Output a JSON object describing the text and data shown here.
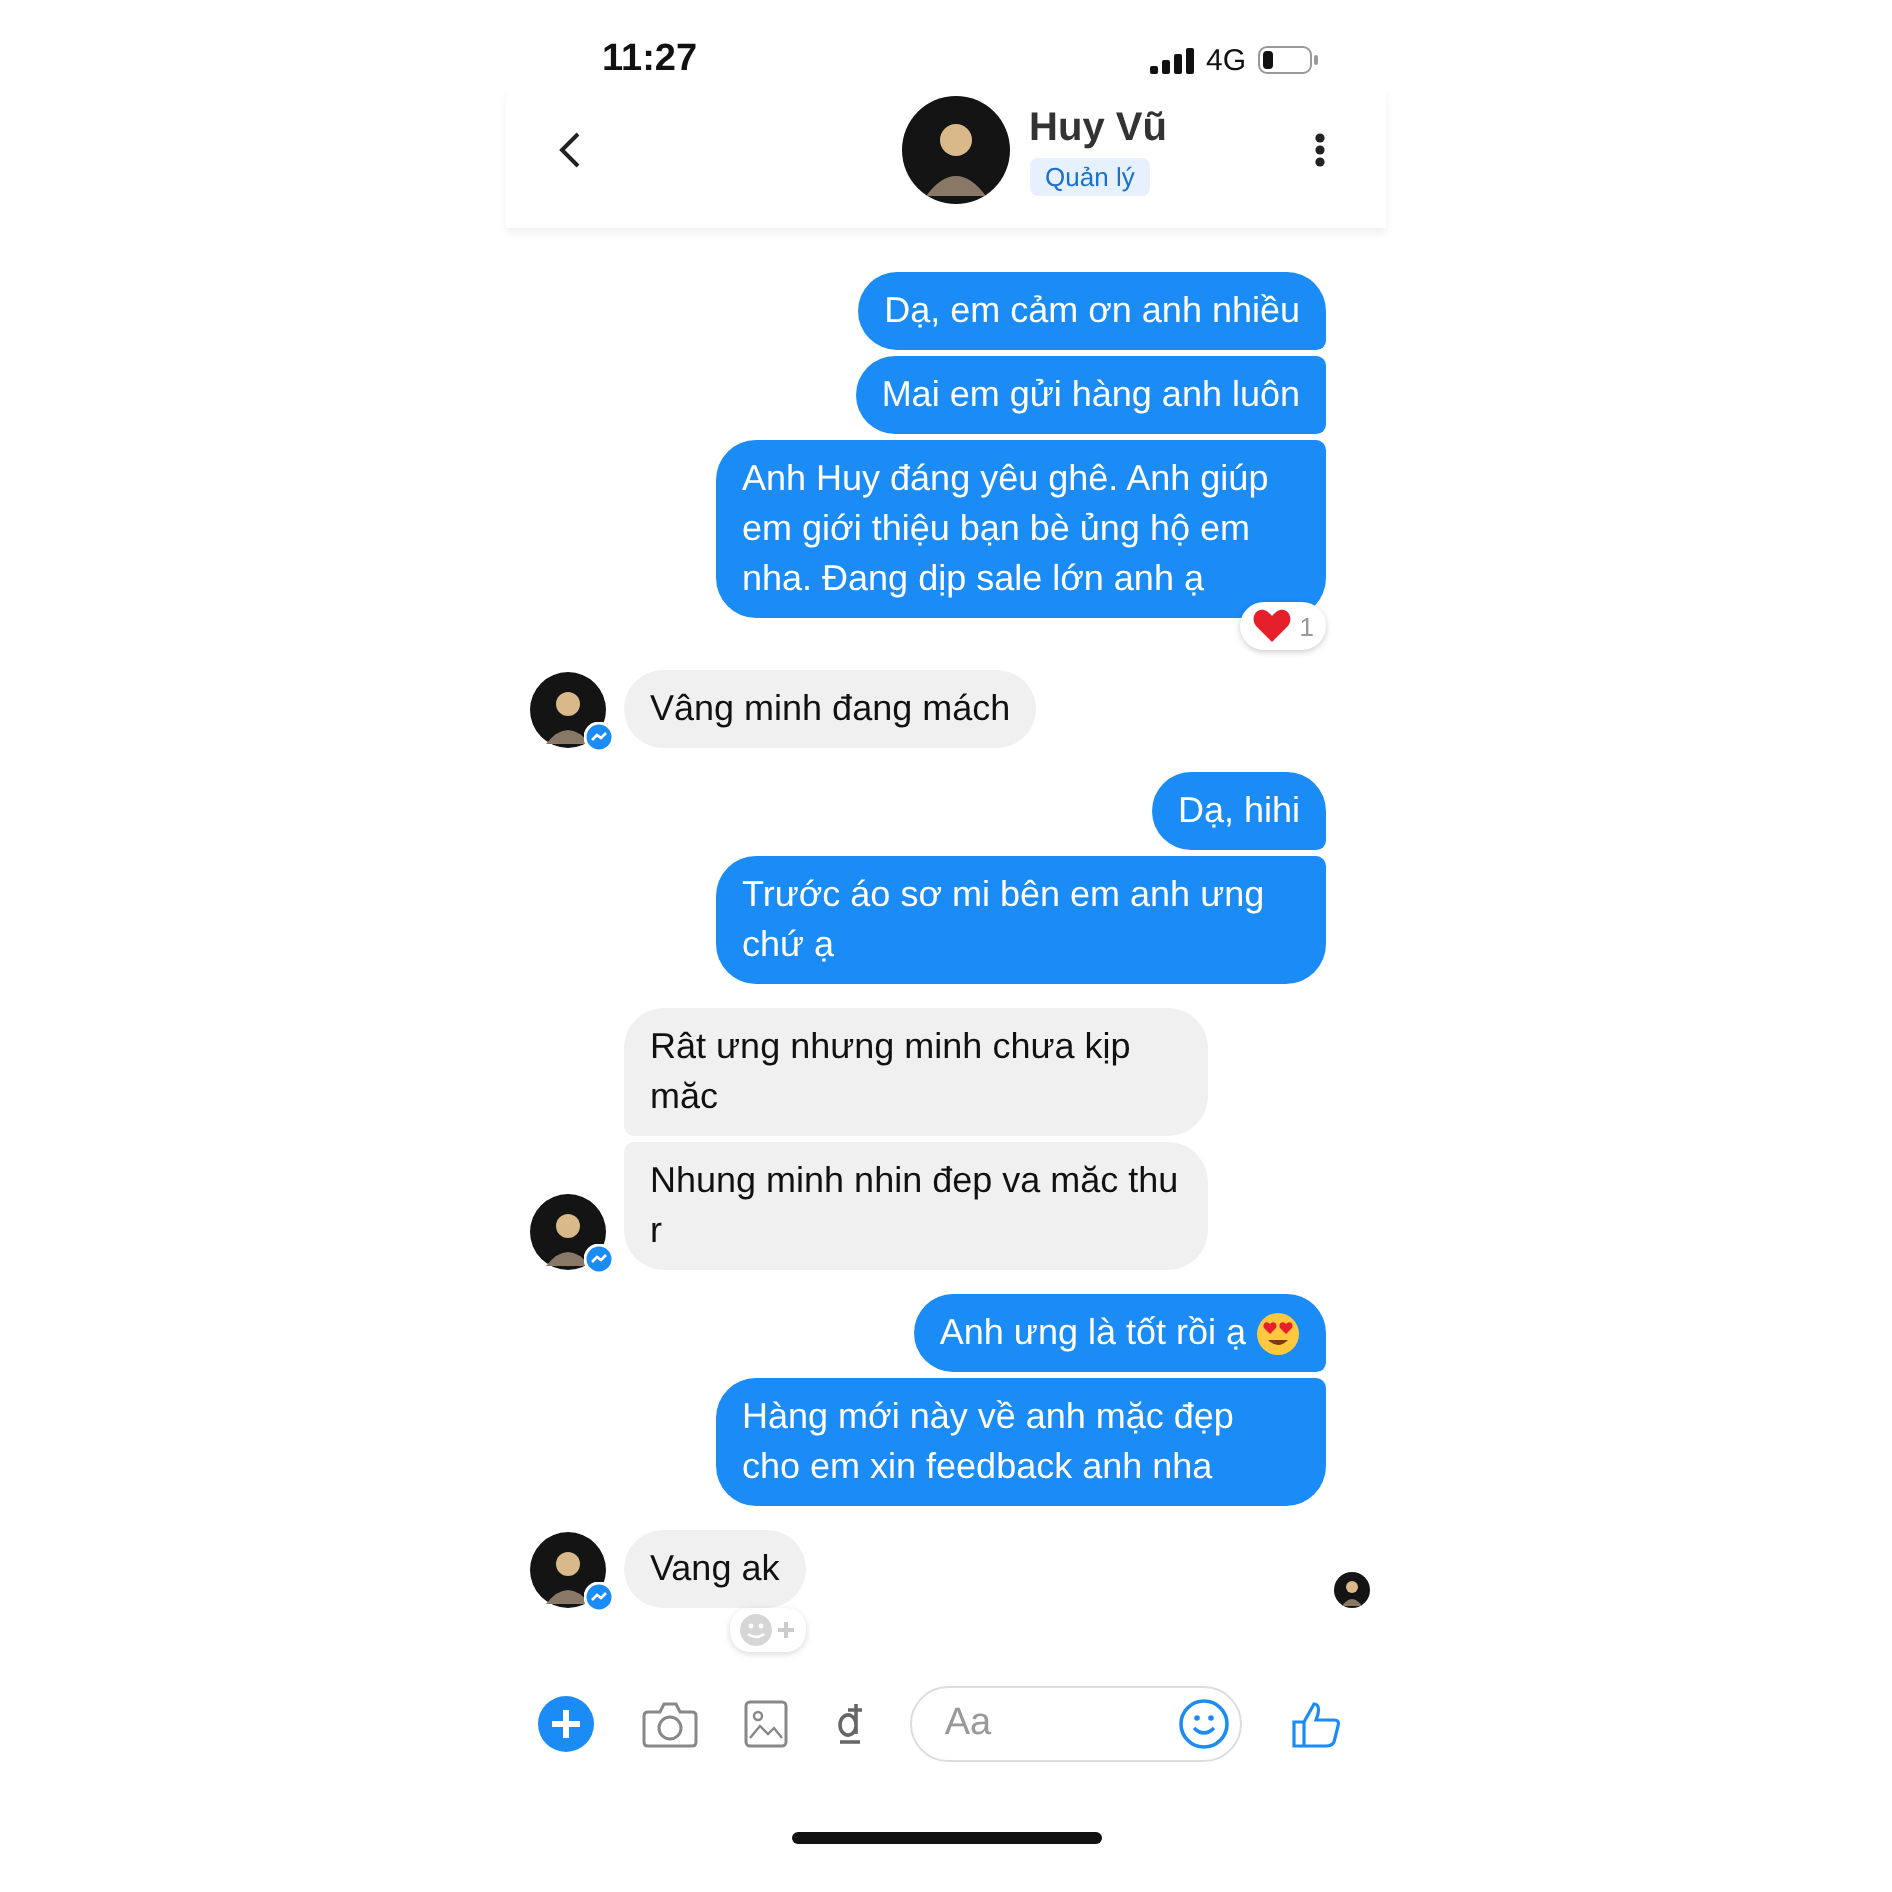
{
  "status_bar": {
    "time": "11:27",
    "network": "4G"
  },
  "header": {
    "name": "Huy Vũ",
    "badge": "Quản lý"
  },
  "messages": [
    {
      "kind": "me",
      "text": "Dạ, em cảm ơn anh nhiều"
    },
    {
      "kind": "me",
      "text": "Mai em gửi hàng anh luôn"
    },
    {
      "kind": "me",
      "text": "Anh Huy đáng yêu ghê. Anh giúp em giới thiệu bạn bè ủng hộ em nha. Đang dịp sale lớn anh ạ",
      "reaction": {
        "count": "1"
      }
    },
    {
      "kind": "them",
      "text": "Vâng minh đang mách"
    },
    {
      "kind": "me",
      "text": "Dạ, hihi"
    },
    {
      "kind": "me",
      "text": "Trước áo sơ mi bên em anh ưng chứ ạ"
    },
    {
      "kind": "them",
      "text": "Rât ưng nhưng minh chưa kịp măc"
    },
    {
      "kind": "them",
      "text": "Nhung minh nhin đep va măc thu r"
    },
    {
      "kind": "me",
      "text": "Anh ưng là tốt rồi ạ",
      "emoji": true
    },
    {
      "kind": "me",
      "text": "Hàng mới này về anh mặc đẹp cho em xin feedback anh nha"
    },
    {
      "kind": "them",
      "text": "Vang ak",
      "add_reaction": true
    }
  ],
  "composer": {
    "placeholder": "Aa"
  }
}
